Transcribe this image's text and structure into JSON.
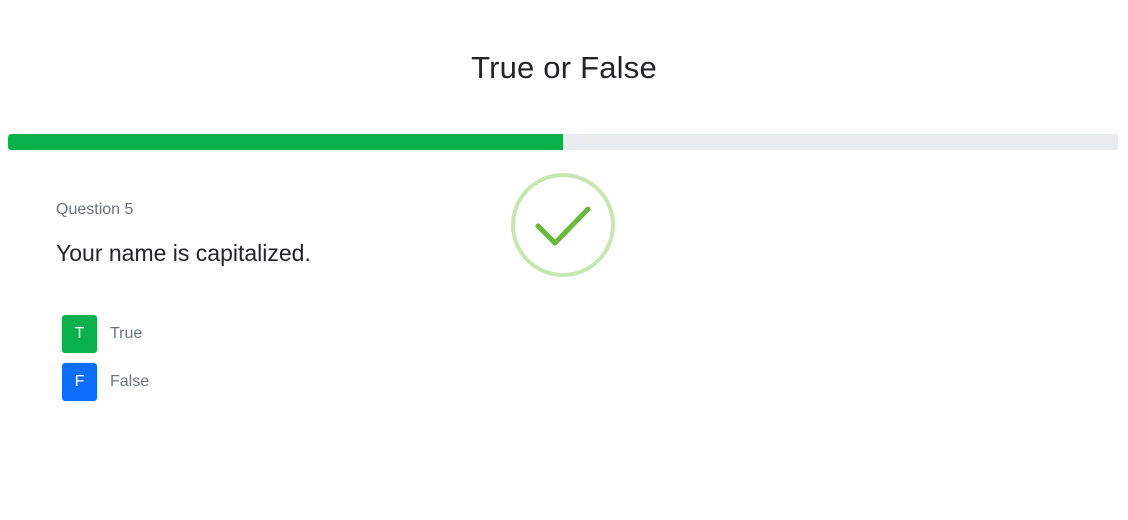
{
  "quiz": {
    "title": "True or False",
    "progress_fraction": 0.5,
    "progress_color": "#0ab04a",
    "track_color": "#e9ecef"
  },
  "feedback": {
    "icon": "checkmark-icon",
    "ring_color": "#c6e7b0",
    "check_color": "#6ab83c"
  },
  "question": {
    "number_label": "Question 5",
    "text": "Your name is capitalized."
  },
  "options": [
    {
      "key": "T",
      "label": "True",
      "color": "#0ab04a"
    },
    {
      "key": "F",
      "label": "False",
      "color": "#0d6efd"
    }
  ]
}
